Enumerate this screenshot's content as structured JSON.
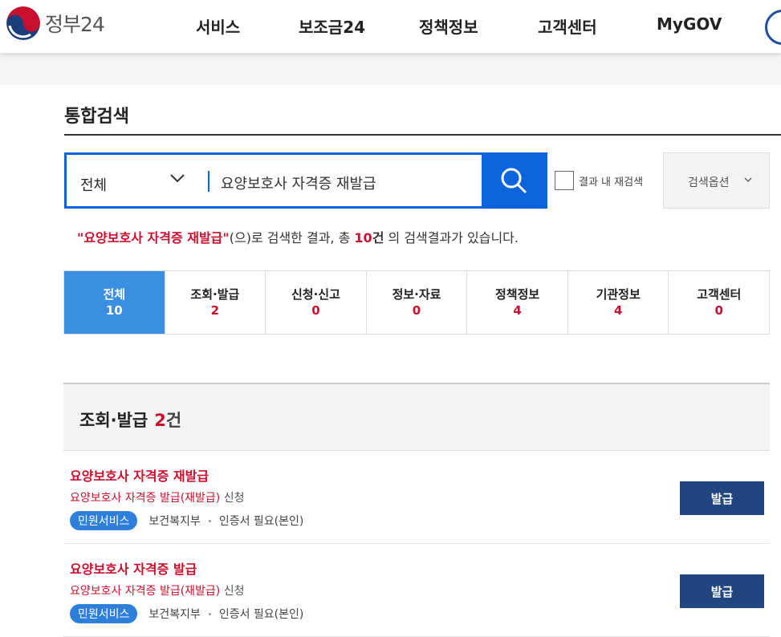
{
  "header": {
    "logo_text": "정부24",
    "nav": [
      "서비스",
      "보조금24",
      "정책정보",
      "고객센터",
      "MyGOV"
    ]
  },
  "search": {
    "title": "통합검색",
    "scope": "전체",
    "query": "요양보호사 자격증 재발급",
    "recheck_label": "결과 내 재검색",
    "options_label": "검색옵션"
  },
  "summary": {
    "keyword": "\"요양보호사 자격증 재발급\"",
    "middle": "(으)로 검색한 결과, 총 ",
    "count": "10",
    "unit": "건",
    "tail": " 의 검색결과가 있습니다."
  },
  "tabs": [
    {
      "label": "전체",
      "count": "10",
      "active": true
    },
    {
      "label": "조회·발급",
      "count": "2"
    },
    {
      "label": "신청·신고",
      "count": "0"
    },
    {
      "label": "정보·자료",
      "count": "0"
    },
    {
      "label": "정책정보",
      "count": "4"
    },
    {
      "label": "기관정보",
      "count": "4"
    },
    {
      "label": "고객센터",
      "count": "0"
    }
  ],
  "section": {
    "title": "조회·발급",
    "count": "2",
    "unit": "건"
  },
  "results": [
    {
      "title": "요양보호사 자격증 재발급",
      "desc_highlight": "요양보호사 자격증 발급(재발급)",
      "desc_tail": " 신청",
      "badge": "민원서비스",
      "agency": "보건복지부",
      "requirement": "인증서 필요(본인)",
      "button": "발급"
    },
    {
      "title": "요양보호사 자격증 발급",
      "desc_highlight": "요양보호사 자격증 발급(재발급)",
      "desc_tail": " 신청",
      "badge": "민원서비스",
      "agency": "보건복지부",
      "requirement": "인증서 필요(본인)",
      "button": "발급"
    }
  ],
  "colors": {
    "brand_blue": "#0b64dc",
    "tab_active": "#3b8fe0",
    "accent_red": "#c8102e",
    "button_navy": "#21457e"
  }
}
